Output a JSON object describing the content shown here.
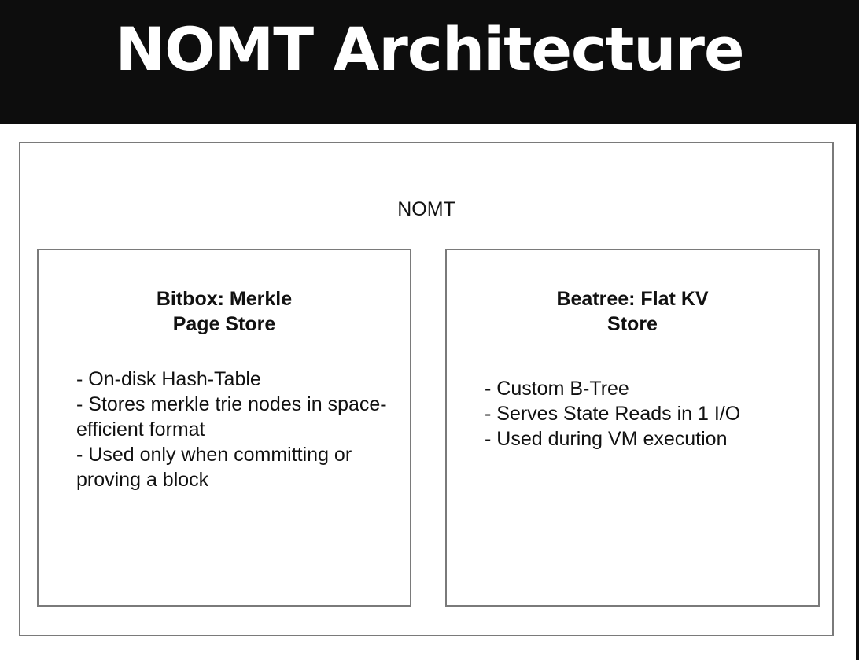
{
  "title": "NOMT Architecture",
  "diagram": {
    "outer": {
      "label": "NOMT"
    },
    "boxes": [
      {
        "title_lines": [
          "Bitbox: Merkle",
          "Page Store"
        ],
        "bullets": [
          "On-disk Hash-Table",
          "Stores merkle trie nodes in space-efficient format",
          "Used only when committing or proving a block"
        ]
      },
      {
        "title_lines": [
          "Beatree: Flat KV",
          "Store"
        ],
        "bullets": [
          "Custom B-Tree",
          "Serves State Reads in 1 I/O",
          "Used during VM execution"
        ]
      }
    ]
  }
}
